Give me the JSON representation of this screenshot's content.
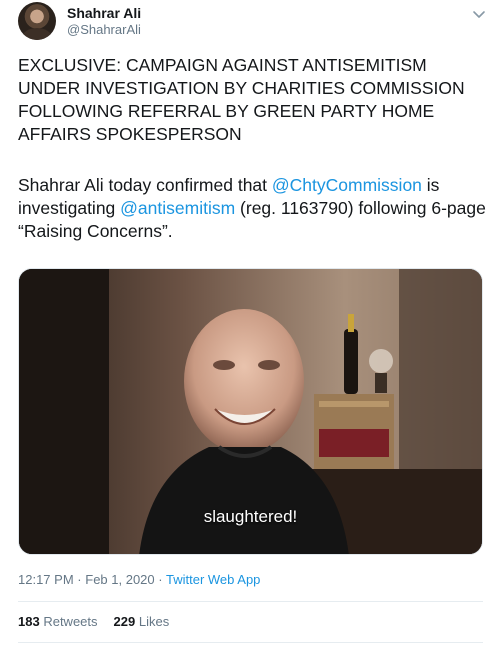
{
  "author": {
    "display_name": "Shahrar Ali",
    "handle": "@ShahrarAli"
  },
  "tweet": {
    "headline": "EXCLUSIVE: CAMPAIGN AGAINST ANTISEMITISM UNDER INVESTIGATION BY CHARITIES COMMISSION FOLLOWING  REFERRAL BY GREEN PARTY HOME AFFAIRS SPOKESPERSON",
    "body_part1": "Shahrar Ali today confirmed that ",
    "mention1": "@ChtyCommission",
    "body_part2": " is investigating ",
    "mention2": "@antisemitism",
    "body_part3": " (reg. 1163790) following 6-page “Raising Concerns”."
  },
  "media": {
    "subtitle": "slaughtered!"
  },
  "meta": {
    "time": "12:17 PM",
    "separator": "·",
    "date": "Feb 1, 2020",
    "app": "Twitter Web App"
  },
  "stats": {
    "retweets_count": "183",
    "retweets_label": "Retweets",
    "likes_count": "229",
    "likes_label": "Likes"
  },
  "icons": {
    "caret": "chevron-down-icon"
  },
  "colors": {
    "link": "#1b95e0",
    "secondary_text": "#657786",
    "primary_text": "#14171a"
  }
}
